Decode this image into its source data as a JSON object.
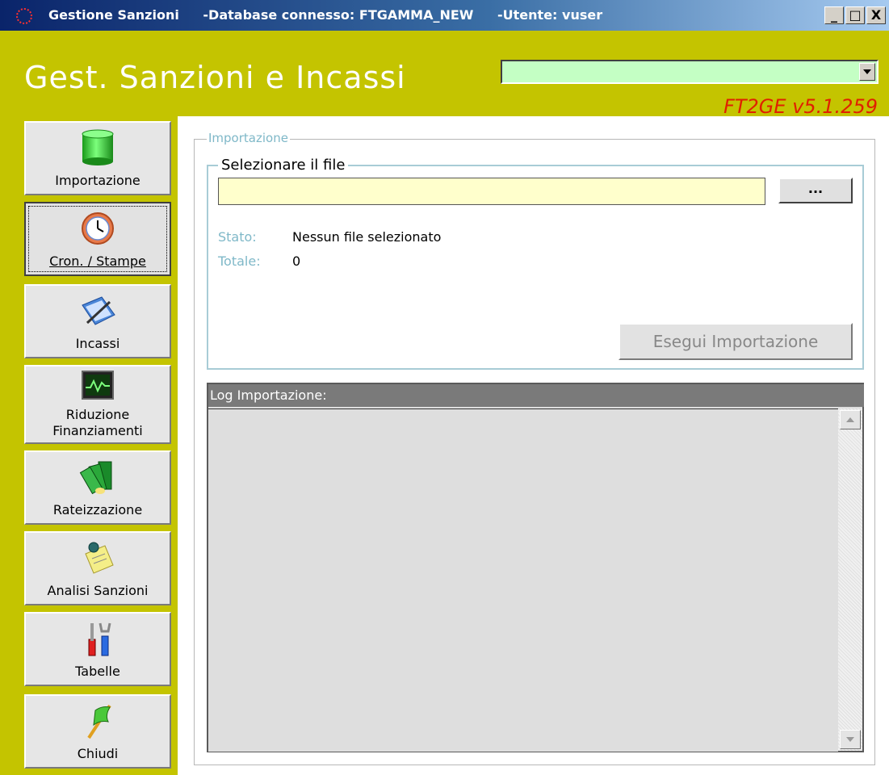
{
  "window": {
    "title_app": "Gestione Sanzioni",
    "title_db": "-Database connesso: FTGAMMA_NEW",
    "title_user": "-Utente: vuser",
    "minimize": "_",
    "maximize": "□",
    "close": "X"
  },
  "header": {
    "title": "Gest. Sanzioni e Incassi",
    "version": "FT2GE v5.1.259",
    "combo_value": ""
  },
  "sidebar": {
    "items": [
      {
        "label": "Importazione",
        "icon": "cylinder-icon",
        "active": false
      },
      {
        "label": "Cron. / Stampe",
        "icon": "clock-icon",
        "active": true
      },
      {
        "label": "Incassi",
        "icon": "notebook-pen-icon",
        "active": false
      },
      {
        "label": "Riduzione\nFinanziamenti",
        "icon": "monitor-wave-icon",
        "active": false
      },
      {
        "label": "Rateizzazione",
        "icon": "money-stack-icon",
        "active": false
      },
      {
        "label": "Analisi Sanzioni",
        "icon": "pinned-note-icon",
        "active": false
      },
      {
        "label": "Tabelle",
        "icon": "tools-icon",
        "active": false
      },
      {
        "label": "Chiudi",
        "icon": "flag-icon",
        "active": false
      }
    ]
  },
  "main": {
    "group_title": "Importazione",
    "file_group_title": "Selezionare il file",
    "file_path": "",
    "browse_label": "...",
    "stato_label": "Stato:",
    "stato_value": "Nessun file selezionato",
    "totale_label": "Totale:",
    "totale_value": "0",
    "execute_label": "Esegui Importazione",
    "log_title": "Log Importazione:",
    "log_content": ""
  },
  "colors": {
    "header_bg": "#c4c400",
    "title_bar": "#0a246a",
    "version_red": "#e02000",
    "combo_green": "#c4ffc4",
    "file_input_yellow": "#ffffcc",
    "label_teal": "#7fb8c8"
  }
}
